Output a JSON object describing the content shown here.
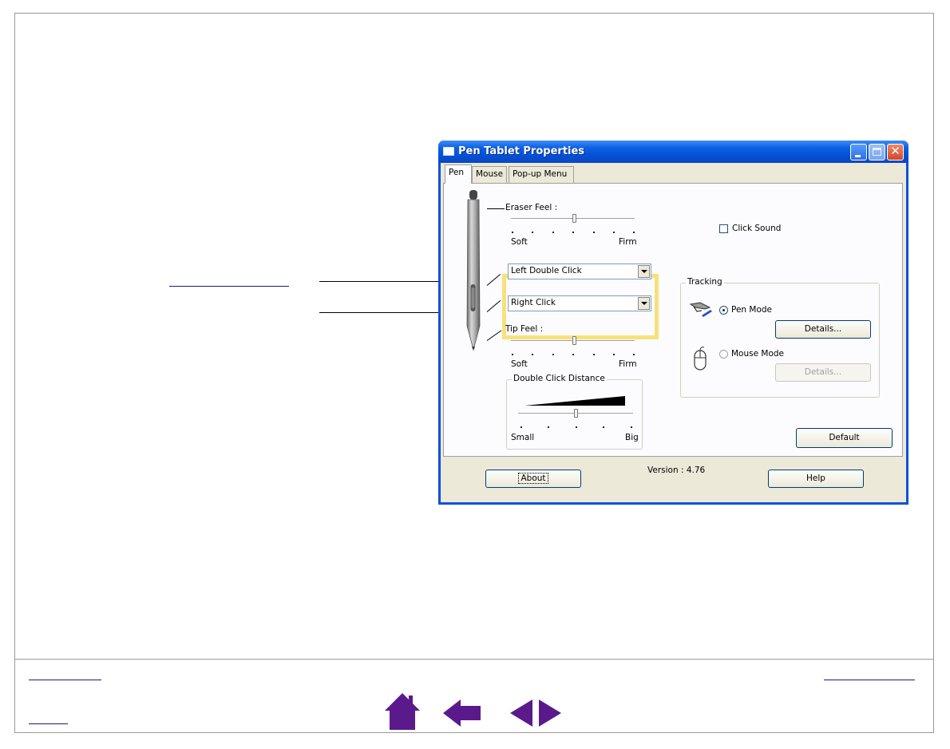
{
  "dialog": {
    "title": "Pen Tablet Properties",
    "tabs": [
      {
        "label": "Pen",
        "active": true
      },
      {
        "label": "Mouse",
        "active": false
      },
      {
        "label": "Pop-up Menu",
        "active": false
      }
    ],
    "eraser_feel": {
      "label": "Eraser Feel :",
      "min_label": "Soft",
      "max_label": "Firm",
      "level": 0.5
    },
    "side_switch_upper": {
      "value": "Left Double Click"
    },
    "side_switch_lower": {
      "value": "Right Click"
    },
    "tip_feel": {
      "label": "Tip Feel :",
      "min_label": "Soft",
      "max_label": "Firm",
      "level": 0.5
    },
    "double_click_distance": {
      "label": "Double Click Distance",
      "min_label": "Small",
      "max_label": "Big",
      "level": 0.5
    },
    "click_sound": {
      "label": "Click Sound",
      "checked": false
    },
    "tracking": {
      "title": "Tracking",
      "pen_mode": {
        "label": "Pen Mode",
        "selected": true,
        "details_label": "Details..."
      },
      "mouse_mode": {
        "label": "Mouse Mode",
        "selected": false,
        "details_label": "Details..."
      }
    },
    "default_button": "Default",
    "about_button": "About",
    "version": "Version : 4.76",
    "help_button": "Help"
  },
  "icons": {
    "nav": [
      "home-icon",
      "back-arrow-icon",
      "previous-page-icon",
      "next-page-icon"
    ],
    "nav_color": "#5b1a8c"
  },
  "colors": {
    "titlebar": "#0a5fe0",
    "highlight": "#f7e17a",
    "dialog_face": "#ece9d8"
  }
}
